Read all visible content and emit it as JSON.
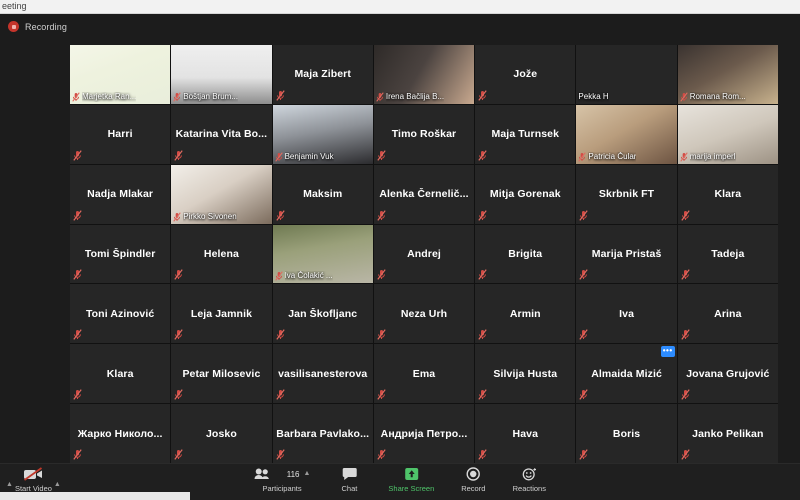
{
  "window": {
    "os_title": "eeting",
    "recording_label": "Recording",
    "active_speaker_border_color": "#7ec844"
  },
  "grid": {
    "columns": 7,
    "rows": 7,
    "tiles": [
      {
        "name": "Marjetka Ran...",
        "video": true,
        "muted": true,
        "active_speaker": true,
        "bg": "logo-slide"
      },
      {
        "name": "Boštjan Brum...",
        "video": true,
        "muted": true,
        "active_speaker": false,
        "bg": "portrait-man"
      },
      {
        "name": "Maja Zibert",
        "video": false,
        "muted": true,
        "active_speaker": false
      },
      {
        "name": "Irena Bačlija B...",
        "video": true,
        "muted": true,
        "active_speaker": false,
        "bg": "room-woman"
      },
      {
        "name": "Jože",
        "video": false,
        "muted": true,
        "active_speaker": false
      },
      {
        "name": "Pekka H",
        "video": true,
        "muted": false,
        "active_speaker": false,
        "bg": "man-glasses"
      },
      {
        "name": "Romana Rom...",
        "video": true,
        "muted": true,
        "active_speaker": false,
        "bg": "blonde-woman"
      },
      {
        "name": "Harri",
        "video": false,
        "muted": true,
        "active_speaker": false
      },
      {
        "name": "Katarina Vita Bo...",
        "video": false,
        "muted": true,
        "active_speaker": false
      },
      {
        "name": "Benjamin Vuk",
        "video": true,
        "muted": true,
        "active_speaker": false,
        "bg": "man-sunglasses"
      },
      {
        "name": "Timo Roškar",
        "video": false,
        "muted": true,
        "active_speaker": false
      },
      {
        "name": "Maja Turnsek",
        "video": false,
        "muted": true,
        "active_speaker": false
      },
      {
        "name": "Patricia Čular",
        "video": true,
        "muted": true,
        "active_speaker": false,
        "bg": "woman-office"
      },
      {
        "name": "marija imperl",
        "video": true,
        "muted": true,
        "active_speaker": false,
        "bg": "elder-woman"
      },
      {
        "name": "Nadja Mlakar",
        "video": false,
        "muted": true,
        "active_speaker": false
      },
      {
        "name": "Pirkko Sivonen",
        "video": true,
        "muted": true,
        "active_speaker": false,
        "bg": "woman-curtain"
      },
      {
        "name": "Maksim",
        "video": false,
        "muted": true,
        "active_speaker": false
      },
      {
        "name": "Alenka  Černelič...",
        "video": false,
        "muted": true,
        "active_speaker": false
      },
      {
        "name": "Mitja Gorenak",
        "video": false,
        "muted": true,
        "active_speaker": false
      },
      {
        "name": "Skrbnik FT",
        "video": false,
        "muted": true,
        "active_speaker": false
      },
      {
        "name": "Klara",
        "video": false,
        "muted": true,
        "active_speaker": false
      },
      {
        "name": "Tomi Špindler",
        "video": false,
        "muted": true,
        "active_speaker": false
      },
      {
        "name": "Helena",
        "video": false,
        "muted": true,
        "active_speaker": false
      },
      {
        "name": "Iva Čolakić ...",
        "video": true,
        "muted": true,
        "active_speaker": false,
        "bg": "outdoor-two"
      },
      {
        "name": "Andrej",
        "video": false,
        "muted": true,
        "active_speaker": false
      },
      {
        "name": "Brigita",
        "video": false,
        "muted": true,
        "active_speaker": false
      },
      {
        "name": "Marija Pristaš",
        "video": false,
        "muted": true,
        "active_speaker": false
      },
      {
        "name": "Tadeja",
        "video": false,
        "muted": true,
        "active_speaker": false
      },
      {
        "name": "Toni Azinović",
        "video": false,
        "muted": true,
        "active_speaker": false
      },
      {
        "name": "Leja Jamnik",
        "video": false,
        "muted": true,
        "active_speaker": false
      },
      {
        "name": "Jan Škofljanc",
        "video": false,
        "muted": true,
        "active_speaker": false
      },
      {
        "name": "Neza Urh",
        "video": false,
        "muted": true,
        "active_speaker": false
      },
      {
        "name": "Armin",
        "video": false,
        "muted": true,
        "active_speaker": false
      },
      {
        "name": "Iva",
        "video": false,
        "muted": true,
        "active_speaker": false
      },
      {
        "name": "Arina",
        "video": false,
        "muted": true,
        "active_speaker": false
      },
      {
        "name": "Klara",
        "video": false,
        "muted": true,
        "active_speaker": false
      },
      {
        "name": "Petar Milosevic",
        "video": false,
        "muted": true,
        "active_speaker": false
      },
      {
        "name": "vasilisanesterova",
        "video": false,
        "muted": true,
        "active_speaker": false
      },
      {
        "name": "Ema",
        "video": false,
        "muted": true,
        "active_speaker": false
      },
      {
        "name": "Silvija Husta",
        "video": false,
        "muted": true,
        "active_speaker": false
      },
      {
        "name": "Almaida Mizić",
        "video": false,
        "muted": true,
        "active_speaker": false,
        "options_label": "•••"
      },
      {
        "name": "Jovana Grujović",
        "video": false,
        "muted": true,
        "active_speaker": false
      },
      {
        "name": "Жарко Николо...",
        "video": false,
        "muted": true,
        "active_speaker": false
      },
      {
        "name": "Josko",
        "video": false,
        "muted": true,
        "active_speaker": false
      },
      {
        "name": "Barbara  Pavlako...",
        "video": false,
        "muted": true,
        "active_speaker": false
      },
      {
        "name": "Андрија Петро...",
        "video": false,
        "muted": true,
        "active_speaker": false
      },
      {
        "name": "Hava",
        "video": false,
        "muted": true,
        "active_speaker": false
      },
      {
        "name": "Boris",
        "video": false,
        "muted": true,
        "active_speaker": false
      },
      {
        "name": "Janko Pelikan",
        "video": false,
        "muted": true,
        "active_speaker": false
      }
    ]
  },
  "toolbar": {
    "start_video_label": "Start Video",
    "participants_label": "Participants",
    "participants_count": "116",
    "chat_label": "Chat",
    "share_screen_label": "Share Screen",
    "share_screen_color": "#4fc46a",
    "record_label": "Record",
    "reactions_label": "Reactions"
  }
}
